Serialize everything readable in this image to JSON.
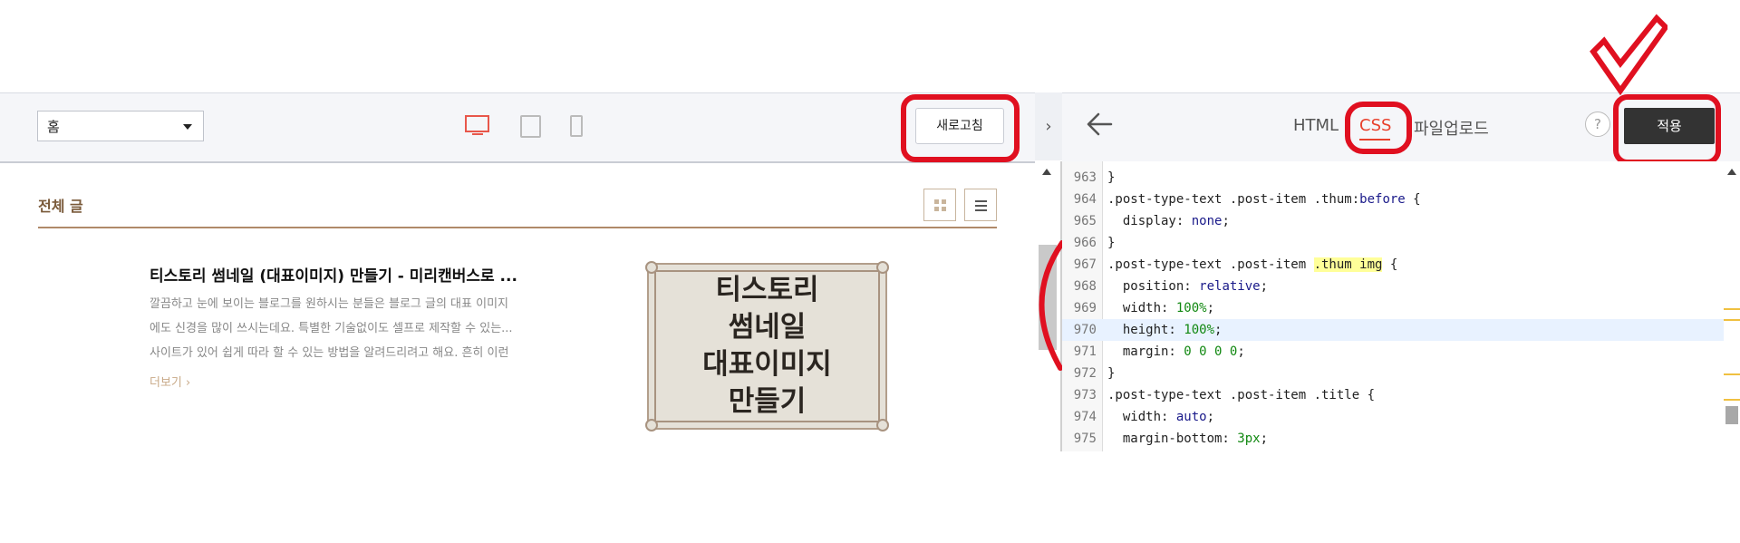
{
  "preview_toolbar": {
    "page_select_value": "홈",
    "device_icons": [
      "desktop-icon",
      "tablet-icon",
      "mobile-icon"
    ],
    "refresh_label": "새로고침",
    "collapse_icon": "chevron-right-icon"
  },
  "preview": {
    "section_title": "전체 글",
    "view_buttons": [
      "grid-view-icon",
      "list-view-icon"
    ],
    "post": {
      "title": "티스토리 썸네일 (대표이미지) 만들기 - 미리캔버스로 ...",
      "excerpt_lines": [
        "깔끔하고 눈에 보이는 블로그를 원하시는 분들은 블로그 글의 대표 이미지",
        "에도 신경을 많이 쓰시는데요. 특별한 기술없이도 셀프로 제작할 수 있는...",
        "사이트가 있어 쉽게 따라 할 수 있는 방법을 알려드리려고 해요. 흔히 이런"
      ],
      "more_label": "더보기 ›",
      "thumbnail_lines": [
        "티스토리",
        "썸네일",
        "대표이미지",
        "만들기"
      ]
    }
  },
  "editor_toolbar": {
    "back_icon": "arrow-left-icon",
    "tabs": [
      {
        "label": "HTML",
        "active": false
      },
      {
        "label": "CSS",
        "active": true
      },
      {
        "label": "파일업로드",
        "active": false
      }
    ],
    "help_label": "?",
    "apply_label": "적용"
  },
  "editor": {
    "lines": [
      {
        "num": "963",
        "text": "}"
      },
      {
        "num": "964",
        "text": ".post-type-text .post-item .thum:before {"
      },
      {
        "num": "965",
        "text": "  display: none;"
      },
      {
        "num": "966",
        "text": "}"
      },
      {
        "num": "967",
        "text": ".post-type-text .post-item .thum img {"
      },
      {
        "num": "968",
        "text": "  position: relative;"
      },
      {
        "num": "969",
        "text": "  width: 100%;"
      },
      {
        "num": "970",
        "text": "  height: 100%;",
        "active": true
      },
      {
        "num": "971",
        "text": "  margin: 0 0 0 0;"
      },
      {
        "num": "972",
        "text": "}"
      },
      {
        "num": "973",
        "text": ".post-type-text .post-item .title {"
      },
      {
        "num": "974",
        "text": "  width: auto;"
      },
      {
        "num": "975",
        "text": "  margin-bottom: 3px;"
      }
    ]
  },
  "colors": {
    "accent_red": "#e8402c",
    "annotation_red": "#e01020",
    "apply_bg": "#333333"
  }
}
